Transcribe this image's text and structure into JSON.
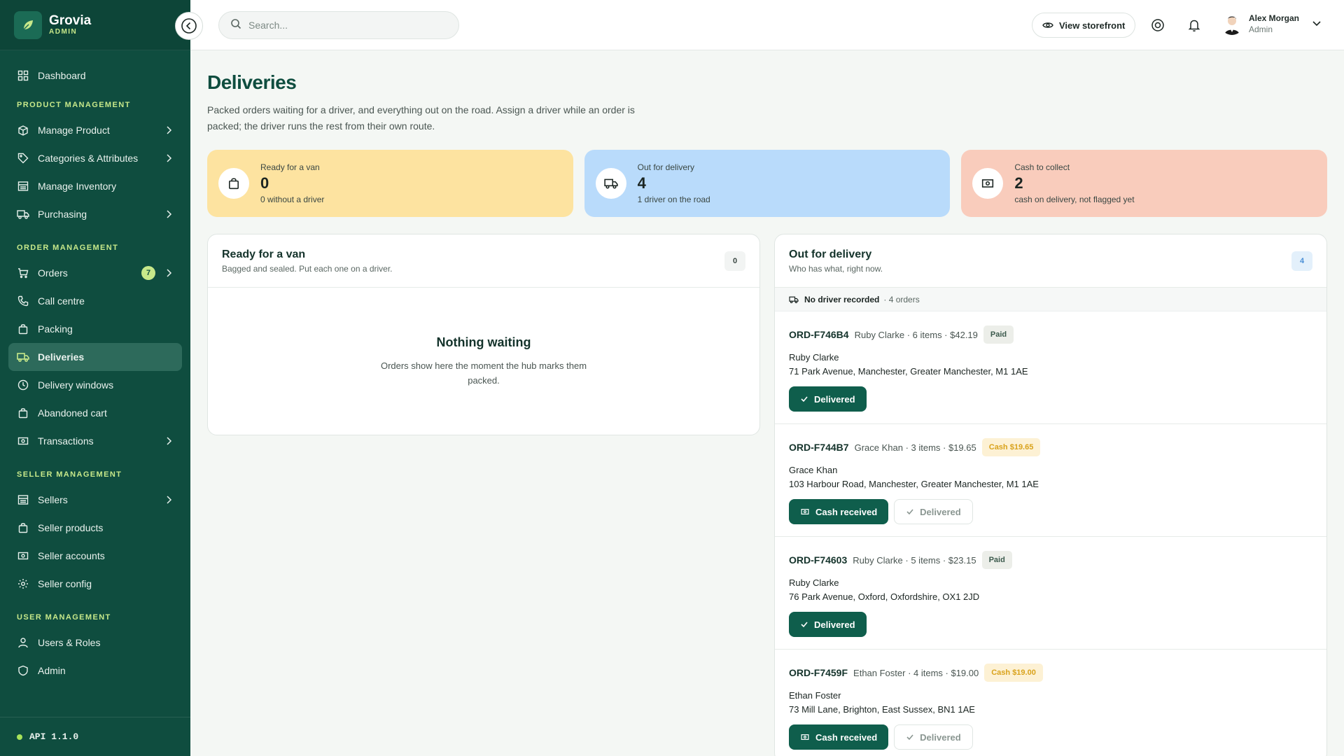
{
  "brand": {
    "name": "Grovia",
    "sub": "ADMIN"
  },
  "sidebar": {
    "dashboard": "Dashboard",
    "sections": {
      "product": "PRODUCT MANAGEMENT",
      "order": "ORDER MANAGEMENT",
      "seller": "SELLER MANAGEMENT",
      "user": "USER MANAGEMENT"
    },
    "product_items": [
      "Manage Product",
      "Categories & Attributes",
      "Manage Inventory",
      "Purchasing"
    ],
    "order_items": [
      "Orders",
      "Call centre",
      "Packing",
      "Deliveries",
      "Delivery windows",
      "Abandoned cart",
      "Transactions"
    ],
    "orders_badge": "7",
    "seller_items": [
      "Sellers",
      "Seller products",
      "Seller accounts",
      "Seller config"
    ],
    "user_items": [
      "Users & Roles",
      "Admin"
    ],
    "api_version": "API 1.1.0"
  },
  "topbar": {
    "search_placeholder": "Search...",
    "storefront_label": "View storefront",
    "user_name": "Alex Morgan",
    "user_role": "Admin"
  },
  "page": {
    "title": "Deliveries",
    "description": "Packed orders waiting for a driver, and everything out on the road. Assign a driver while an order is packed; the driver runs the rest from their own route."
  },
  "stats": [
    {
      "label": "Ready for a van",
      "value": "0",
      "sub": "0 without a driver",
      "color": "#fde3a0"
    },
    {
      "label": "Out for delivery",
      "value": "4",
      "sub": "1 driver on the road",
      "color": "#b9dbfb"
    },
    {
      "label": "Cash to collect",
      "value": "2",
      "sub": "cash on delivery, not flagged yet",
      "color": "#f9ccbc"
    }
  ],
  "ready_panel": {
    "title": "Ready for a van",
    "sub": "Bagged and sealed. Put each one on a driver.",
    "count": "0",
    "empty_title": "Nothing waiting",
    "empty_desc": "Orders show here the moment the hub marks them packed."
  },
  "out_panel": {
    "title": "Out for delivery",
    "sub": "Who has what, right now.",
    "count": "4",
    "group_name": "No driver recorded",
    "group_count": "· 4 orders",
    "orders": [
      {
        "id": "ORD-F746B4",
        "meta": "Ruby Clarke · 6 items · $42.19",
        "pill": "Paid",
        "pill_type": "paid",
        "name": "Ruby Clarke",
        "address": "71 Park Avenue, Manchester, Greater Manchester, M1 1AE",
        "primary": "Delivered",
        "secondary": ""
      },
      {
        "id": "ORD-F744B7",
        "meta": "Grace Khan · 3 items · $19.65",
        "pill": "Cash $19.65",
        "pill_type": "cash",
        "name": "Grace Khan",
        "address": "103 Harbour Road, Manchester, Greater Manchester, M1 1AE",
        "primary": "Cash received",
        "secondary": "Delivered"
      },
      {
        "id": "ORD-F74603",
        "meta": "Ruby Clarke · 5 items · $23.15",
        "pill": "Paid",
        "pill_type": "paid",
        "name": "Ruby Clarke",
        "address": "76 Park Avenue, Oxford, Oxfordshire, OX1 2JD",
        "primary": "Delivered",
        "secondary": ""
      },
      {
        "id": "ORD-F7459F",
        "meta": "Ethan Foster · 4 items · $19.00",
        "pill": "Cash $19.00",
        "pill_type": "cash",
        "name": "Ethan Foster",
        "address": "73 Mill Lane, Brighton, East Sussex, BN1 1AE",
        "primary": "Cash received",
        "secondary": "Delivered"
      }
    ]
  }
}
